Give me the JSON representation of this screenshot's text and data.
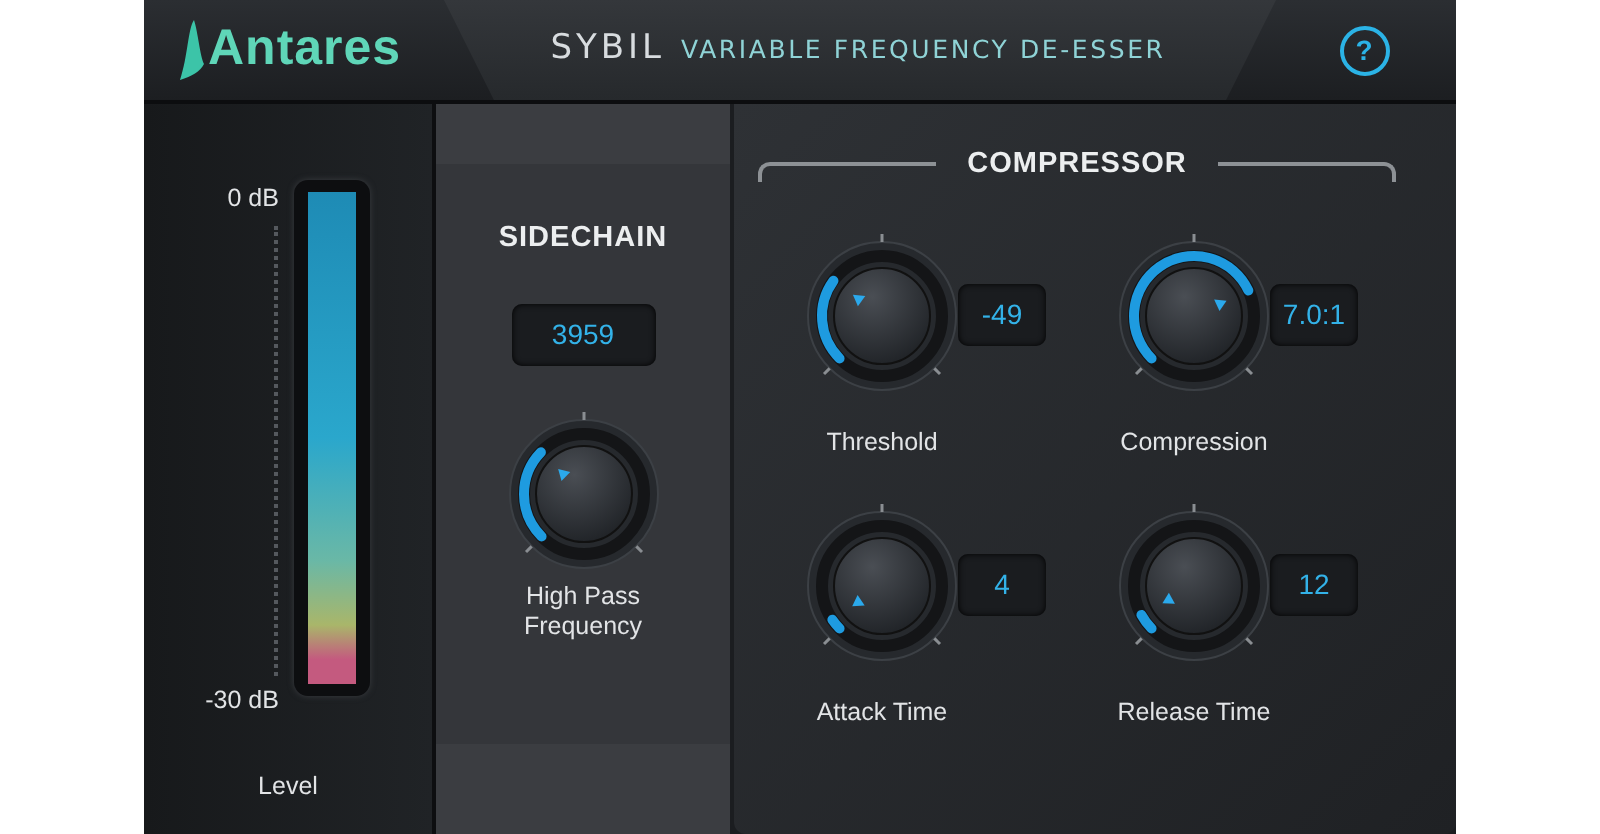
{
  "header": {
    "logo": "Antares",
    "product": "SYBIL",
    "subtitle": "VARIABLE FREQUENCY DE-ESSER",
    "help": "?"
  },
  "meter": {
    "top_label": "0 dB",
    "bottom_label": "-30 dB",
    "label": "Level",
    "level": 1.0
  },
  "sidechain": {
    "title": "SIDECHAIN",
    "value": "3959",
    "knob": {
      "label": "High Pass Frequency"
    }
  },
  "compressor": {
    "title": "COMPRESSOR",
    "knobs": [
      {
        "label": "Threshold",
        "value": "-49"
      },
      {
        "label": "Compression",
        "value": "7.0:1"
      },
      {
        "label": "Attack Time",
        "value": "4"
      },
      {
        "label": "Release Time",
        "value": "12"
      }
    ]
  }
}
